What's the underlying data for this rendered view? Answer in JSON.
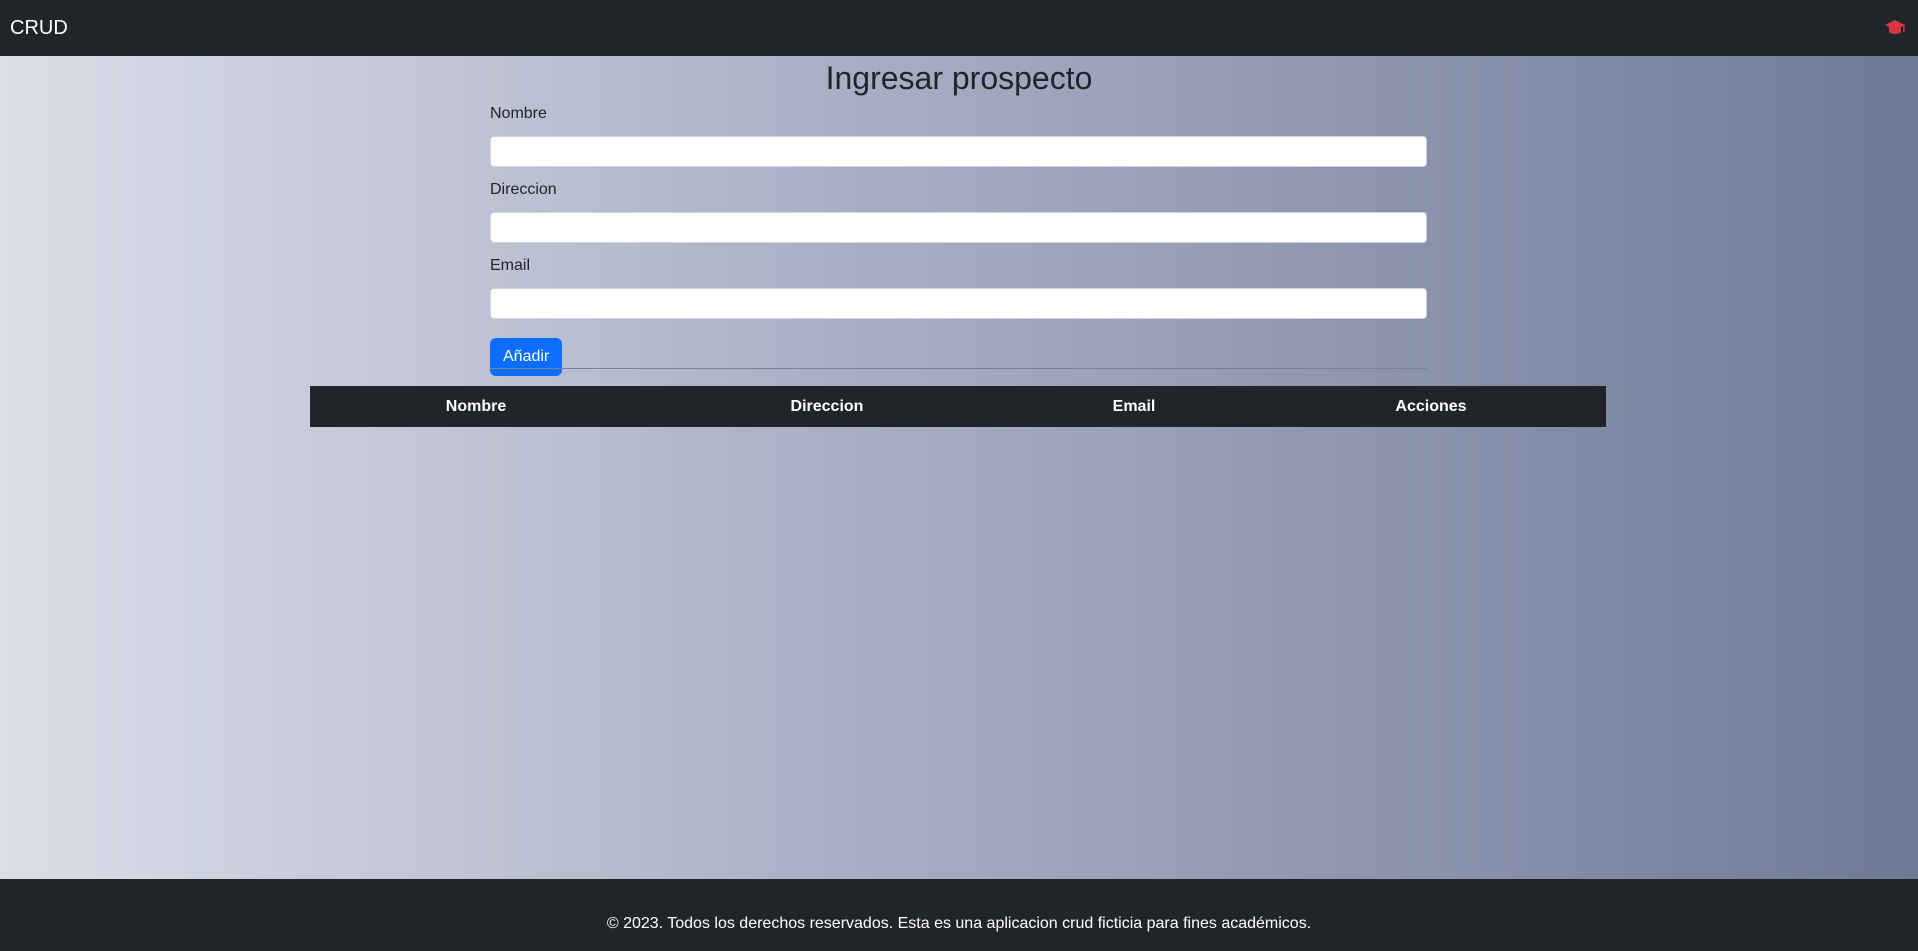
{
  "navbar": {
    "brand": "CRUD",
    "icon": "graduation-cap-icon",
    "icon_color": "#dc3545"
  },
  "page": {
    "title": "Ingresar prospecto"
  },
  "form": {
    "nombre_label": "Nombre",
    "nombre_value": "",
    "direccion_label": "Direccion",
    "direccion_value": "",
    "email_label": "Email",
    "email_value": "",
    "add_button_label": "Añadir",
    "button_color": "#0d6efd"
  },
  "table": {
    "columns": [
      "Nombre",
      "Direccion",
      "Email",
      "Acciones"
    ],
    "rows": []
  },
  "footer": {
    "text": "© 2023. Todos los derechos reservados. Esta es una aplicacion crud ficticia para fines académicos."
  },
  "colors": {
    "dark": "#212529"
  }
}
